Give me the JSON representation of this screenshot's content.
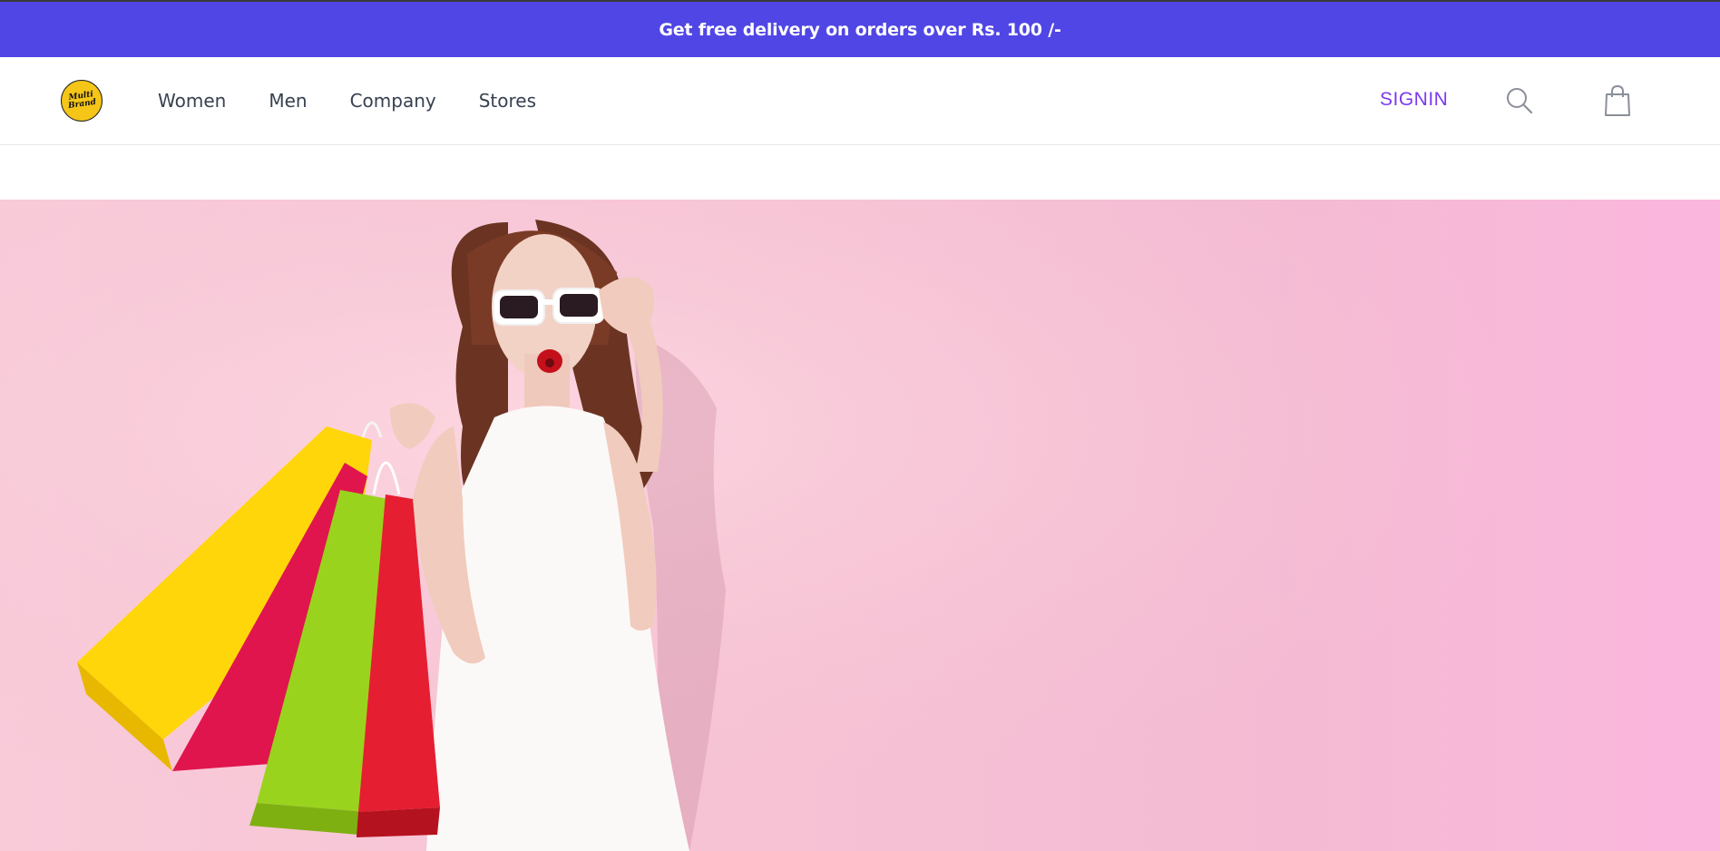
{
  "promo": {
    "text": "Get free delivery on orders over Rs. 100 /-"
  },
  "logo": {
    "text": "Multi Brand"
  },
  "nav": {
    "links": [
      "Women",
      "Men",
      "Company",
      "Stores"
    ],
    "signin_label": "SIGNIN"
  },
  "icons": {
    "search": "search-icon",
    "cart": "shopping-bag-icon"
  },
  "colors": {
    "promo_background": "#5046e5",
    "accent": "#7c3aed",
    "hero_background": "#f6c2d4"
  },
  "hero": {
    "image": "woman-with-shopping-bags"
  }
}
